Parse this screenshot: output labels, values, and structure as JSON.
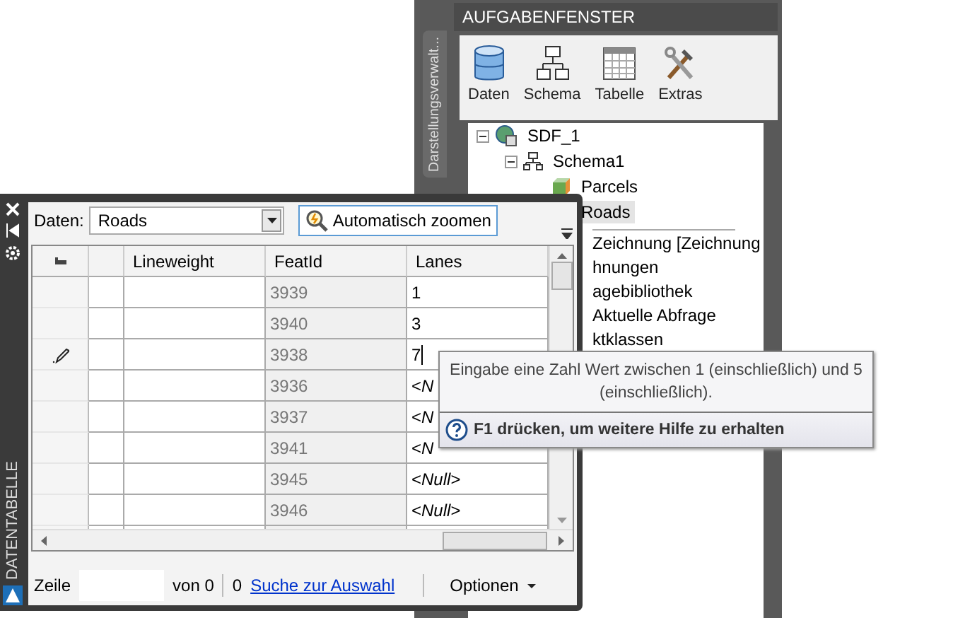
{
  "task_pane": {
    "side_tab": "Darstellungsverwalt...",
    "title": "AUFGABENFENSTER",
    "tools": [
      {
        "label": "Daten",
        "kind": "database"
      },
      {
        "label": "Schema",
        "kind": "schema"
      },
      {
        "label": "Tabelle",
        "kind": "table"
      },
      {
        "label": "Extras",
        "kind": "tools"
      }
    ],
    "tree": [
      {
        "label": "SDF_1",
        "kind": "source",
        "expanded": true,
        "selected": false,
        "children": [
          {
            "label": "Schema1",
            "kind": "schema",
            "expanded": true,
            "selected": false,
            "children": [
              {
                "label": "Parcels",
                "kind": "class",
                "selected": false
              },
              {
                "label": "Roads",
                "selected": true
              }
            ]
          }
        ]
      }
    ],
    "items": [
      "Zeichnung [Zeichnung",
      "hnungen",
      "agebibliothek",
      "Aktuelle Abfrage",
      "ktklassen"
    ]
  },
  "data_table": {
    "title": "DATENTABELLE",
    "data_label": "Daten:",
    "source": "Roads",
    "zoom_button": "Automatisch zoomen",
    "columns": [
      "Lineweight",
      "FeatId",
      "Lanes"
    ],
    "rows": [
      {
        "feat_id": "3939",
        "lanes": "1",
        "editing": false
      },
      {
        "feat_id": "3940",
        "lanes": "3",
        "editing": false
      },
      {
        "feat_id": "3938",
        "lanes": "7",
        "editing": true
      },
      {
        "feat_id": "3936",
        "lanes": "<*N*",
        "editing": false
      },
      {
        "feat_id": "3937",
        "lanes": "<*N*",
        "editing": false
      },
      {
        "feat_id": "3941",
        "lanes": "<*N*",
        "editing": false
      },
      {
        "feat_id": "3945",
        "lanes": "<*Null*>",
        "editing": false
      },
      {
        "feat_id": "3946",
        "lanes": "<*Null*>",
        "editing": false
      }
    ],
    "footer": {
      "row_label": "Zeile",
      "of": "von 0",
      "count": "0",
      "link": "Suche zur Auswahl",
      "options": "Optionen"
    }
  },
  "tooltip": {
    "text": "Eingabe eine Zahl Wert zwischen 1 (einschließlich) und 5 (einschließlich).",
    "help": "F1 drücken, um weitere Hilfe zu erhalten"
  }
}
